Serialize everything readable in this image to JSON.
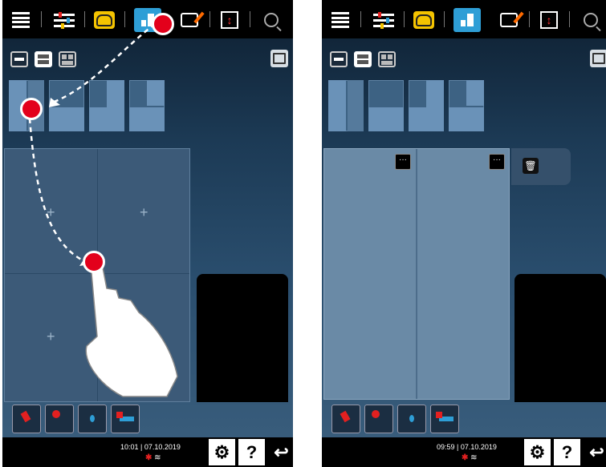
{
  "left_panel": {
    "footer": {
      "time": "10:01",
      "date": "07.10.2019",
      "help_label": "?"
    }
  },
  "right_panel": {
    "footer": {
      "time": "09:59",
      "date": "07.10.2019",
      "help_label": "?"
    },
    "dots_label": "···",
    "trash_label": "🗑"
  },
  "icons": {
    "menu": "menu-icon",
    "settings": "sliders-icon",
    "chef": "chef-hat-icon",
    "layout": "layout-icon",
    "edit": "edit-icon",
    "updown": "vertical-scroll-icon",
    "search": "search-icon",
    "gear": "gear-icon",
    "back": "back-arrow-icon"
  },
  "colors": {
    "accent": "#2e9ed6",
    "chef": "#f5c400",
    "red": "#e3001b"
  }
}
